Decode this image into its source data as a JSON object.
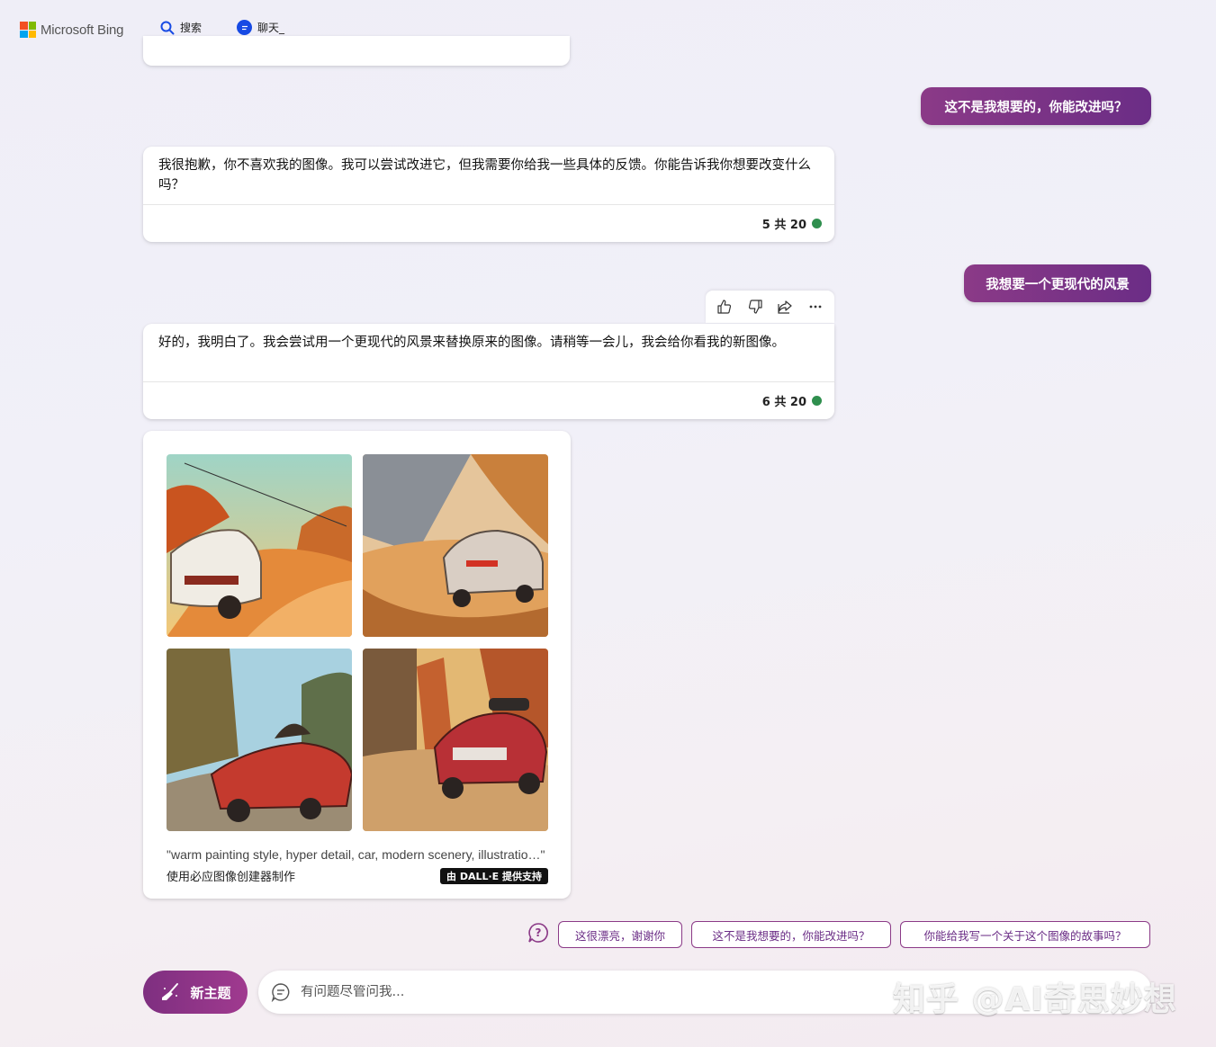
{
  "header": {
    "brand": "Microsoft Bing",
    "nav": {
      "search_label": "搜索",
      "chat_label": "聊天_"
    }
  },
  "messages": [
    {
      "role": "user",
      "text": "这不是我想要的，你能改进吗？"
    },
    {
      "role": "bot",
      "text": "我很抱歉，你不喜欢我的图像。我可以尝试改进它，但我需要你给我一些具体的反馈。你能告诉我你想要改变什么吗？",
      "turn": "5 共 20"
    },
    {
      "role": "user",
      "text": "我想要一个更现代的风景"
    },
    {
      "role": "bot",
      "text": "好的，我明白了。我会尝试用一个更现代的风景来替换原来的图像。请稍等一会儿，我会给你看我的新图像。",
      "turn": "6 共 20"
    }
  ],
  "image_result": {
    "prompt": "\"warm painting style, hyper detail, car, modern scenery, illustratio…\"",
    "made_with": "使用必应图像创建器制作",
    "badge": "由 DALL·E 提供支持"
  },
  "suggestions": [
    "这很漂亮，谢谢你",
    "这不是我想要的，你能改进吗？",
    "你能给我写一个关于这个图像的故事吗？"
  ],
  "composer": {
    "new_topic_label": "新主题",
    "placeholder": "有问题尽管问我..."
  },
  "watermark": "知乎 @AI奇思妙想",
  "colors": {
    "accent_purple": "#8b3a87",
    "nav_blue": "#174ae4",
    "status_green": "#2f8f4e"
  }
}
